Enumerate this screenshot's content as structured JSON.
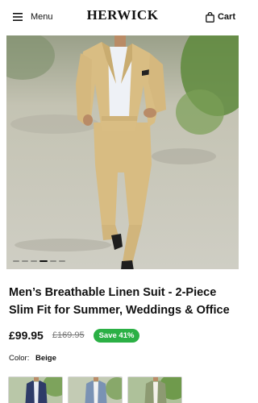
{
  "header": {
    "menu_label": "Menu",
    "brand": "HERWICK",
    "cart_label": "Cart",
    "icons": [
      "hamburger-icon",
      "shopping-bag-icon"
    ]
  },
  "gallery": {
    "image_alt": "Man wearing a beige linen two-piece slim fit suit",
    "slide_count": 6,
    "active_slide": 3
  },
  "product": {
    "title": "Men’s Breathable Linen Suit - 2-Piece Slim Fit for Summer, Weddings & Office",
    "price": "£99.95",
    "old_price": "£169.95",
    "save_badge": "Save 41%",
    "color_label": "Color:",
    "color_value": "Beige"
  },
  "swatches": [
    {
      "name": "Navy",
      "suit_color": "#2e3b68",
      "shirt_color": "#e9ecf3"
    },
    {
      "name": "Blue",
      "suit_color": "#7a92b4",
      "shirt_color": "#f2f2f2"
    },
    {
      "name": "Green",
      "suit_color": "#8d9a72",
      "shirt_color": "#f4f1ea"
    }
  ],
  "colors": {
    "badge_green": "#2bb045",
    "suit_beige": "#d8bc82",
    "text": "#111111"
  }
}
